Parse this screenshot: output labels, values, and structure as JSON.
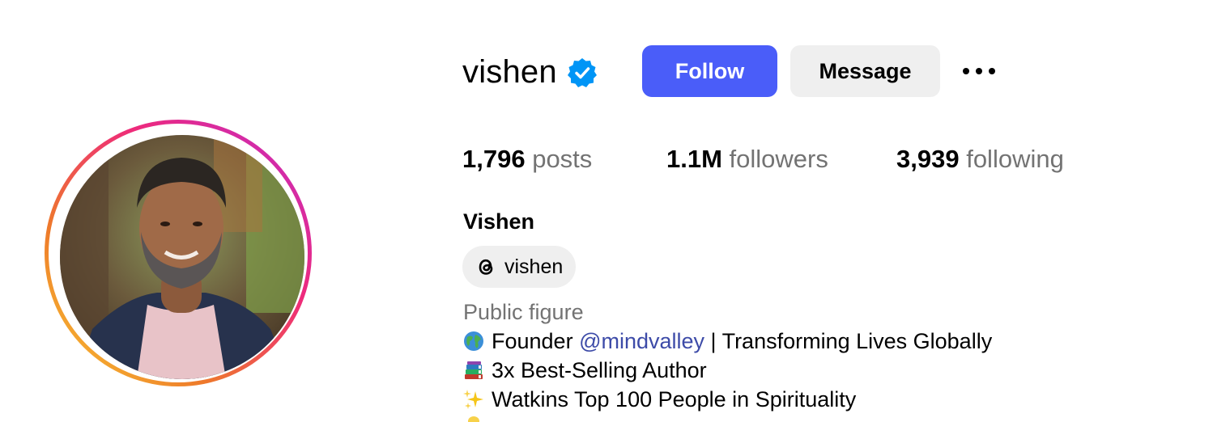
{
  "profile": {
    "username": "vishen",
    "verified": true,
    "full_name": "Vishen",
    "category": "Public figure",
    "accent_color": "#4a5df9",
    "verified_color": "#0095f6"
  },
  "actions": {
    "follow_label": "Follow",
    "message_label": "Message",
    "more_icon": "more-horizontal-icon"
  },
  "stats": {
    "posts_count": "1,796",
    "posts_label": "posts",
    "followers_count": "1.1M",
    "followers_label": "followers",
    "following_count": "3,939",
    "following_label": "following"
  },
  "threads": {
    "icon": "threads-icon",
    "handle": "vishen"
  },
  "bio": {
    "line1": {
      "emoji": "globe-emoji",
      "text_before": "Founder ",
      "mention": "@mindvalley",
      "text_after": " | Transforming Lives Globally"
    },
    "line2": {
      "emoji": "books-emoji",
      "text": "3x Best-Selling Author"
    },
    "line3": {
      "emoji": "sparkles-emoji",
      "text": "Watkins Top 100 People in Spirituality"
    }
  }
}
